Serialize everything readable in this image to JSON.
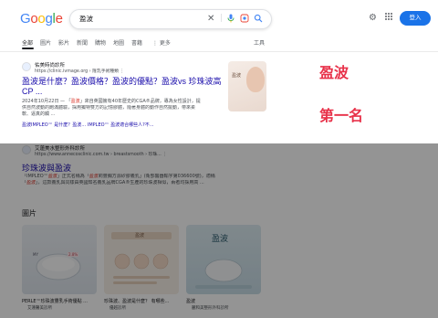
{
  "header": {
    "logo": [
      "G",
      "o",
      "o",
      "g",
      "l",
      "e"
    ],
    "logo_colors": [
      "#4285f4",
      "#ea4335",
      "#fbbc05",
      "#4285f4",
      "#34a853",
      "#ea4335"
    ],
    "query": "盈波",
    "login_label": "登入"
  },
  "tabs": [
    "全部",
    "圖片",
    "影片",
    "新聞",
    "購物",
    "地圖",
    "書籍",
    "⋮ 更多"
  ],
  "tools_label": "工具",
  "result1": {
    "site_name": "佑美時尚診所",
    "site_url": "https://clinic.ivmage.org › 隆乳手術種類 ⋮",
    "title_line1": "盈波是什麼？盈波價格？盈波的優點？盈波vs 珍珠波高",
    "title_line2": "CP ...",
    "snippet_date": "2024年10月22日 — 「",
    "snippet_hl1": "盈波",
    "snippet_a": "」來自英國擁有40年歷史的CGA®品牌，專為女性設計，提",
    "snippet_b": "供自然波動的飽滿體驗，採用獨特雙方的記憶膠體，隨著身體的動作自然擺動，帶來柔",
    "snippet_c": "軟、逼真的觸 ...",
    "links": "盈波IMPLEO™ 是什麼？盈波… IMPLEO™ 盈波適合哪些人?不..."
  },
  "thumb1_text": "盈波",
  "side_labels": {
    "line1": "盈波",
    "line2": "第一名"
  },
  "result2": {
    "site_name": "艾蓮美水整形外科診所",
    "site_url": "https://www.annecosclinic.com.tw › breastsmooth › 珍珠... ⋮",
    "title": "珍珠波與盈波",
    "snippet_a": "「IMPLEO™",
    "snippet_hl": "盈波",
    "snippet_b": "」正式名稱為「",
    "snippet_hl2": "盈波",
    "snippet_c": "莉豐胸方源矽膠義乳」(衛部醫器輸字第036600號)，適稱",
    "snippet_d": "「",
    "snippet_hl3": "盈波",
    "snippet_e": "」，這款義乳與同樣由英國知名義乳品牌CGA®生產的珍珠波相似，兩者均採用高 ..."
  },
  "images_section": {
    "heading": "圖片",
    "cards": [
      {
        "caption": "PERLE™珍珠波豐乳手術優點 ...",
        "source": "艾蓮醫美診所"
      },
      {
        "caption": "珍珠波、盈波是什麼？ 有哪些...",
        "source": "優越診所"
      },
      {
        "caption": "盈波",
        "source": "麗和美整形外科診所"
      }
    ],
    "card2_text": "盈波",
    "card3_text": "盈波",
    "card1_badges": [
      "MY",
      "2.8%"
    ]
  }
}
